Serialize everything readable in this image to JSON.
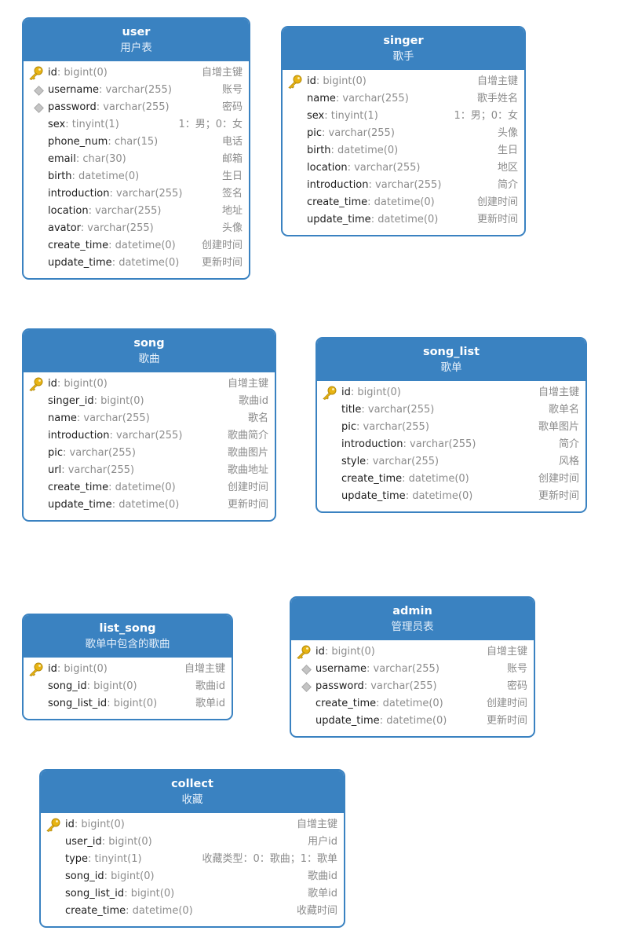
{
  "colors": {
    "header": "#3a82c1",
    "border": "#3a82c1",
    "key": "#e8b413"
  },
  "entities": [
    {
      "name": "user",
      "comment": "用户表",
      "fields": [
        {
          "name": "id",
          "type": ": bigint(0)",
          "comment": "自增主键",
          "icon": "key-icon"
        },
        {
          "name": "username",
          "type": ": varchar(255)",
          "comment": "账号",
          "icon": "diamond-icon"
        },
        {
          "name": "password",
          "type": ": varchar(255)",
          "comment": "密码",
          "icon": "diamond-icon"
        },
        {
          "name": "sex",
          "type": ": tinyint(1)",
          "comment": "1：男；0：女",
          "icon": ""
        },
        {
          "name": "phone_num",
          "type": ": char(15)",
          "comment": "电话",
          "icon": ""
        },
        {
          "name": "email",
          "type": ": char(30)",
          "comment": "邮箱",
          "icon": ""
        },
        {
          "name": "birth",
          "type": ": datetime(0)",
          "comment": "生日",
          "icon": ""
        },
        {
          "name": "introduction",
          "type": ": varchar(255)",
          "comment": "签名",
          "icon": ""
        },
        {
          "name": "location",
          "type": ": varchar(255)",
          "comment": "地址",
          "icon": ""
        },
        {
          "name": "avator",
          "type": ": varchar(255)",
          "comment": "头像",
          "icon": ""
        },
        {
          "name": "create_time",
          "type": ": datetime(0)",
          "comment": "创建时间",
          "icon": ""
        },
        {
          "name": "update_time",
          "type": ": datetime(0)",
          "comment": "更新时间",
          "icon": ""
        }
      ]
    },
    {
      "name": "singer",
      "comment": "歌手",
      "fields": [
        {
          "name": "id",
          "type": ": bigint(0)",
          "comment": "自增主键",
          "icon": "key-icon"
        },
        {
          "name": "name",
          "type": ": varchar(255)",
          "comment": "歌手姓名",
          "icon": ""
        },
        {
          "name": "sex",
          "type": ": tinyint(1)",
          "comment": "1：男；0：女",
          "icon": ""
        },
        {
          "name": "pic",
          "type": ": varchar(255)",
          "comment": "头像",
          "icon": ""
        },
        {
          "name": "birth",
          "type": ": datetime(0)",
          "comment": "生日",
          "icon": ""
        },
        {
          "name": "location",
          "type": ": varchar(255)",
          "comment": "地区",
          "icon": ""
        },
        {
          "name": "introduction",
          "type": ": varchar(255)",
          "comment": "简介",
          "icon": ""
        },
        {
          "name": "create_time",
          "type": ": datetime(0)",
          "comment": "创建时间",
          "icon": ""
        },
        {
          "name": "update_time",
          "type": ": datetime(0)",
          "comment": "更新时间",
          "icon": ""
        }
      ]
    },
    {
      "name": "song",
      "comment": "歌曲",
      "fields": [
        {
          "name": "id",
          "type": ": bigint(0)",
          "comment": "自增主键",
          "icon": "key-icon"
        },
        {
          "name": "singer_id",
          "type": ": bigint(0)",
          "comment": "歌曲id",
          "icon": ""
        },
        {
          "name": "name",
          "type": ": varchar(255)",
          "comment": "歌名",
          "icon": ""
        },
        {
          "name": "introduction",
          "type": ": varchar(255)",
          "comment": "歌曲简介",
          "icon": ""
        },
        {
          "name": "pic",
          "type": ": varchar(255)",
          "comment": "歌曲图片",
          "icon": ""
        },
        {
          "name": "url",
          "type": ": varchar(255)",
          "comment": "歌曲地址",
          "icon": ""
        },
        {
          "name": "create_time",
          "type": ": datetime(0)",
          "comment": "创建时间",
          "icon": ""
        },
        {
          "name": "update_time",
          "type": ": datetime(0)",
          "comment": "更新时间",
          "icon": ""
        }
      ]
    },
    {
      "name": "song_list",
      "comment": "歌单",
      "fields": [
        {
          "name": "id",
          "type": ": bigint(0)",
          "comment": "自增主键",
          "icon": "key-icon"
        },
        {
          "name": "title",
          "type": ": varchar(255)",
          "comment": "歌单名",
          "icon": ""
        },
        {
          "name": "pic",
          "type": ": varchar(255)",
          "comment": "歌单图片",
          "icon": ""
        },
        {
          "name": "introduction",
          "type": ": varchar(255)",
          "comment": "简介",
          "icon": ""
        },
        {
          "name": "style",
          "type": ": varchar(255)",
          "comment": "风格",
          "icon": ""
        },
        {
          "name": "create_time",
          "type": ": datetime(0)",
          "comment": "创建时间",
          "icon": ""
        },
        {
          "name": "update_time",
          "type": ": datetime(0)",
          "comment": "更新时间",
          "icon": ""
        }
      ]
    },
    {
      "name": "list_song",
      "comment": "歌单中包含的歌曲",
      "fields": [
        {
          "name": "id",
          "type": ": bigint(0)",
          "comment": "自增主键",
          "icon": "key-icon"
        },
        {
          "name": "song_id",
          "type": ": bigint(0)",
          "comment": "歌曲id",
          "icon": ""
        },
        {
          "name": "song_list_id",
          "type": ": bigint(0)",
          "comment": "歌单id",
          "icon": ""
        }
      ]
    },
    {
      "name": "admin",
      "comment": "管理员表",
      "fields": [
        {
          "name": "id",
          "type": ": bigint(0)",
          "comment": "自增主键",
          "icon": "key-icon"
        },
        {
          "name": "username",
          "type": ": varchar(255)",
          "comment": "账号",
          "icon": "diamond-icon"
        },
        {
          "name": "password",
          "type": ": varchar(255)",
          "comment": "密码",
          "icon": "diamond-icon"
        },
        {
          "name": "create_time",
          "type": ": datetime(0)",
          "comment": "创建时间",
          "icon": ""
        },
        {
          "name": "update_time",
          "type": ": datetime(0)",
          "comment": "更新时间",
          "icon": ""
        }
      ]
    },
    {
      "name": "collect",
      "comment": "收藏",
      "fields": [
        {
          "name": "id",
          "type": ": bigint(0)",
          "comment": "自增主键",
          "icon": "key-icon"
        },
        {
          "name": "user_id",
          "type": ": bigint(0)",
          "comment": "用户id",
          "icon": ""
        },
        {
          "name": "type",
          "type": ": tinyint(1)",
          "comment": "收藏类型：0：歌曲；1：歌单",
          "icon": ""
        },
        {
          "name": "song_id",
          "type": ": bigint(0)",
          "comment": "歌曲id",
          "icon": ""
        },
        {
          "name": "song_list_id",
          "type": ": bigint(0)",
          "comment": "歌单id",
          "icon": ""
        },
        {
          "name": "create_time",
          "type": ": datetime(0)",
          "comment": "收藏时间",
          "icon": ""
        }
      ]
    }
  ]
}
